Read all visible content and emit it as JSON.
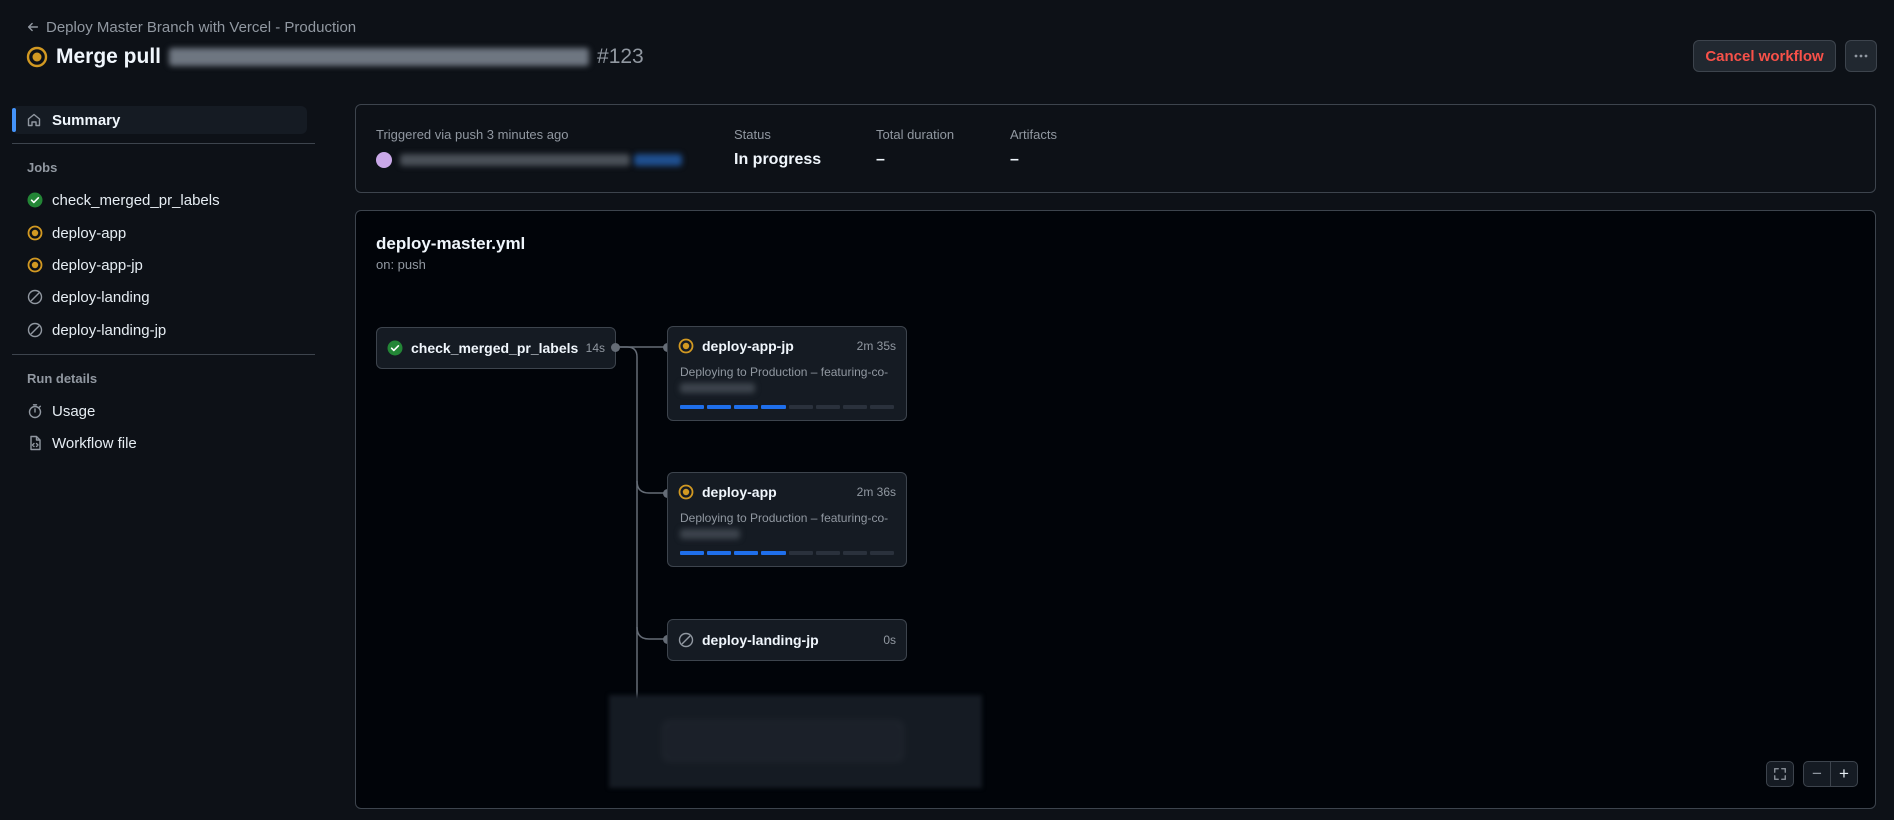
{
  "header": {
    "back_label": "Deploy Master Branch with Vercel - Production",
    "title": "Merge pull",
    "run_number": "#123",
    "cancel_label": "Cancel workflow"
  },
  "sidebar": {
    "summary_label": "Summary",
    "jobs_heading": "Jobs",
    "jobs": [
      {
        "label": "check_merged_pr_labels",
        "status": "success"
      },
      {
        "label": "deploy-app",
        "status": "in-progress"
      },
      {
        "label": "deploy-app-jp",
        "status": "in-progress"
      },
      {
        "label": "deploy-landing",
        "status": "skipped"
      },
      {
        "label": "deploy-landing-jp",
        "status": "skipped"
      }
    ],
    "run_details_heading": "Run details",
    "run_details": [
      {
        "label": "Usage",
        "icon": "stopwatch-icon"
      },
      {
        "label": "Workflow file",
        "icon": "file-code-icon"
      }
    ]
  },
  "summary": {
    "trigger": "Triggered via push 3 minutes ago",
    "status_label": "Status",
    "status_value": "In progress",
    "duration_label": "Total duration",
    "duration_value": "–",
    "artifacts_label": "Artifacts",
    "artifacts_value": "–"
  },
  "graph": {
    "workflow_file": "deploy-master.yml",
    "trigger": "on: push",
    "jobs": [
      {
        "name": "check_merged_pr_labels",
        "duration": "14s",
        "status": "success"
      },
      {
        "name": "deploy-app-jp",
        "duration": "2m 35s",
        "status": "in-progress",
        "description": "Deploying to Production – featuring-co-",
        "progress": 0.5
      },
      {
        "name": "deploy-app",
        "duration": "2m 36s",
        "status": "in-progress",
        "description": "Deploying to Production – featuring-co-",
        "progress": 0.5
      },
      {
        "name": "deploy-landing-jp",
        "duration": "0s",
        "status": "skipped"
      }
    ],
    "zoom_out": "−",
    "zoom_in": "+"
  },
  "colors": {
    "success": "#238636",
    "in_progress": "#d29922",
    "accent": "#4493f8",
    "danger": "#f85149"
  }
}
